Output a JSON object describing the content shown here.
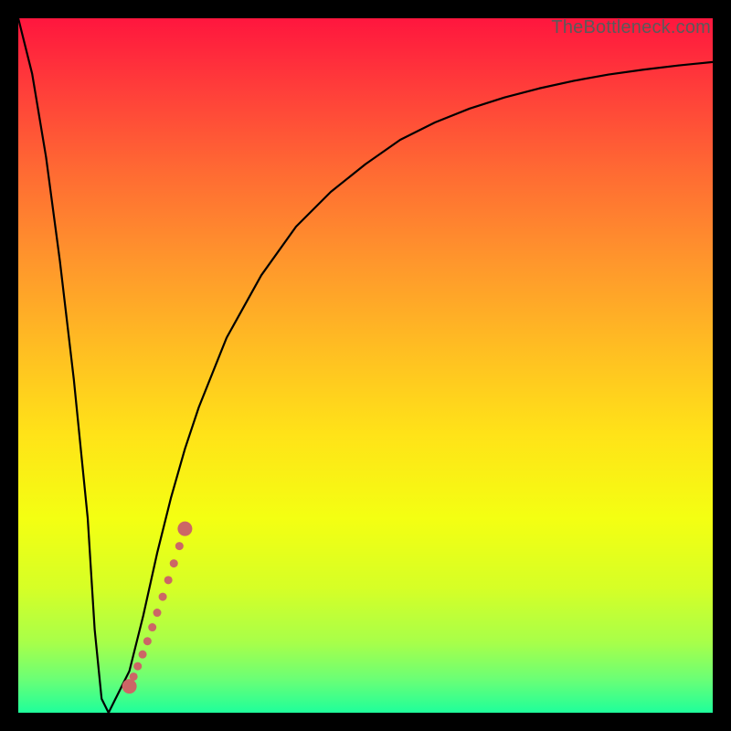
{
  "watermark": "TheBottleneck.com",
  "chart_data": {
    "type": "line",
    "title": "",
    "xlabel": "",
    "ylabel": "",
    "xlim": [
      0,
      100
    ],
    "ylim": [
      0,
      100
    ],
    "grid": false,
    "background": "red-yellow-green-vertical-gradient",
    "series": [
      {
        "name": "bottleneck-curve",
        "x": [
          0,
          2,
          4,
          6,
          8,
          10,
          11,
          12,
          13,
          14,
          16,
          18,
          20,
          22,
          24,
          26,
          30,
          35,
          40,
          45,
          50,
          55,
          60,
          65,
          70,
          75,
          80,
          85,
          90,
          95,
          100
        ],
        "y": [
          100,
          92,
          80,
          65,
          48,
          28,
          12,
          2,
          0,
          2,
          6,
          14,
          23,
          31,
          38,
          44,
          54,
          63,
          70,
          75,
          79,
          82.5,
          85,
          87,
          88.6,
          89.9,
          91,
          91.9,
          92.6,
          93.2,
          93.7
        ],
        "stroke": "#000000",
        "stroke_width": 2.2
      }
    ],
    "highlight": {
      "name": "highlight-segment",
      "points": [
        {
          "x": 16.0,
          "y": 3.8
        },
        {
          "x": 16.6,
          "y": 5.2
        },
        {
          "x": 17.2,
          "y": 6.7
        },
        {
          "x": 17.9,
          "y": 8.4
        },
        {
          "x": 18.6,
          "y": 10.3
        },
        {
          "x": 19.3,
          "y": 12.3
        },
        {
          "x": 20.0,
          "y": 14.4
        },
        {
          "x": 20.8,
          "y": 16.7
        },
        {
          "x": 21.6,
          "y": 19.1
        },
        {
          "x": 22.4,
          "y": 21.5
        },
        {
          "x": 23.2,
          "y": 24.0
        },
        {
          "x": 24.0,
          "y": 26.5
        }
      ],
      "color": "#cc6666",
      "radius_small": 4.5,
      "radius_large": 8
    },
    "gradient_stops": [
      {
        "offset": 0.0,
        "color": "#ff163e"
      },
      {
        "offset": 0.1,
        "color": "#ff3d3a"
      },
      {
        "offset": 0.22,
        "color": "#ff6a33"
      },
      {
        "offset": 0.35,
        "color": "#ff962c"
      },
      {
        "offset": 0.48,
        "color": "#ffbf22"
      },
      {
        "offset": 0.6,
        "color": "#ffe318"
      },
      {
        "offset": 0.72,
        "color": "#f4ff12"
      },
      {
        "offset": 0.82,
        "color": "#d6ff26"
      },
      {
        "offset": 0.9,
        "color": "#a7ff4a"
      },
      {
        "offset": 0.95,
        "color": "#6dff74"
      },
      {
        "offset": 1.0,
        "color": "#1fff9b"
      }
    ]
  }
}
